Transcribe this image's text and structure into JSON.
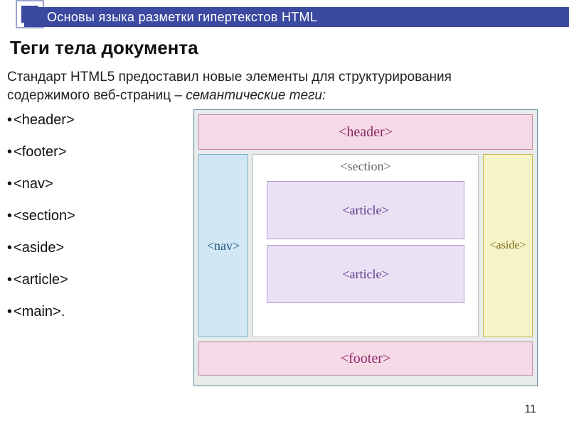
{
  "header_bar": "Основы языка разметки гипертекстов HTML",
  "title": "Теги тела документа",
  "para_line1": "Стандарт HTML5 предоставил новые элементы для структурирования",
  "para_line2a": "содержимого веб-страниц – ",
  "para_line2b_em": "семантические теги:",
  "bullets": {
    "b0": "<header>",
    "b1": "<footer>",
    "b2": "<nav>",
    "b3": "<section>",
    "b4": "<aside>",
    "b5": "<article>",
    "b6": "<main>."
  },
  "diagram": {
    "header": "<header>",
    "nav": "<nav>",
    "section": "<section>",
    "article1": "<article>",
    "article2": "<article>",
    "aside": "<aside>",
    "footer": "<footer>"
  },
  "page_number": "11"
}
